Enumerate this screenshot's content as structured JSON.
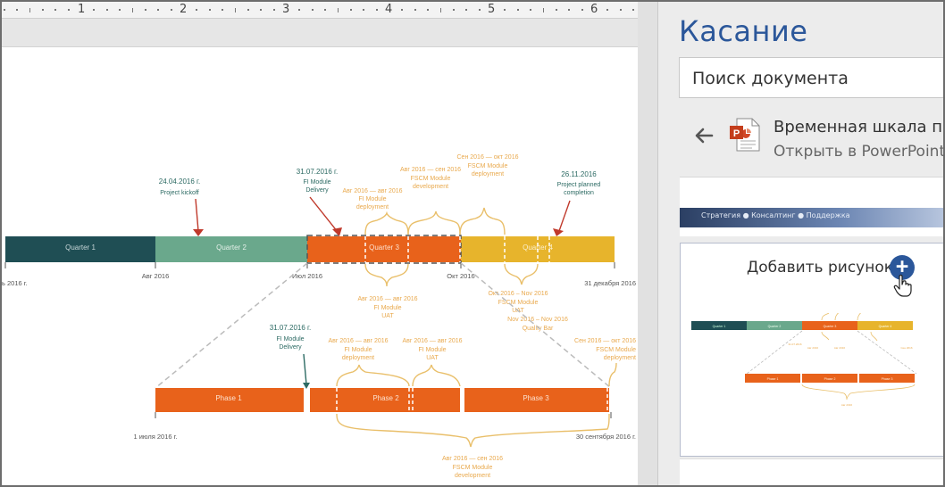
{
  "ruler": {
    "numbers": [
      "1",
      "2",
      "3",
      "4",
      "5",
      "6"
    ]
  },
  "timeline": {
    "main_bar": [
      {
        "label": "Quarter 1",
        "color": "#1f4e54"
      },
      {
        "label": "Quarter 2",
        "color": "#6aa88c"
      },
      {
        "label": "Quarter 3",
        "color": "#e8621b"
      },
      {
        "label": "Quarter 4",
        "color": "#e7b42c"
      }
    ],
    "main_axis": {
      "start": "ь 2016 г.",
      "aug": "Авг 2016",
      "jul": "Июл 2016",
      "oct": "Окт 2016",
      "end": "31 декабря 2016"
    },
    "milestones": [
      {
        "date": "24.04.2016 г.",
        "text": [
          "Project kickoff"
        ]
      },
      {
        "date": "31.07.2016 г.",
        "text": [
          "FI Module",
          "Delivery"
        ]
      },
      {
        "date": "26.11.2016",
        "text": [
          "Project planned",
          "completion"
        ]
      }
    ],
    "top_orange": [
      {
        "range": "Авг 2016 — авг 2016",
        "text": [
          "FI Module",
          "deployment"
        ]
      },
      {
        "range": "Авг 2016 — сен 2016",
        "text": [
          "FSCM Module",
          "development"
        ]
      },
      {
        "range": "Сен 2016 — окт 2016",
        "text": [
          "FSCM Module",
          "deployment"
        ]
      }
    ],
    "below_main": [
      {
        "range": "Авг 2016 — авг 2016",
        "text": [
          "FI Module",
          "UAT"
        ]
      },
      {
        "range": "Окт 2016 – Nov 2016",
        "text": [
          "FSCM Module",
          "UAT"
        ]
      },
      {
        "range": "Nov 2016 – Nov 2016",
        "text": [
          "Quality Bar"
        ]
      }
    ],
    "phase_bar": [
      {
        "label": "Phase 1"
      },
      {
        "label": "Phase 2"
      },
      {
        "label": "Phase 3"
      }
    ],
    "phase_axis": {
      "start": "1 июля 2016 г.",
      "end": "30 сентября 2016 г."
    },
    "phase_milestone": {
      "date": "31.07.2016 г.",
      "text": [
        "FI Module",
        "Delivery"
      ]
    },
    "phase_above": [
      {
        "range": "Авг 2016 — авг 2016",
        "text": [
          "FI Module",
          "deployment"
        ]
      },
      {
        "range": "Авг 2016 — авг 2016",
        "text": [
          "FI Module",
          "UAT"
        ]
      },
      {
        "range": "Сен 2016 — окт 2016",
        "text": [
          "FSCM Module",
          "deployment"
        ]
      }
    ],
    "phase_below": {
      "range": "Авг 2016 — сен 2016",
      "text": [
        "FSCM Module",
        "development"
      ]
    }
  },
  "pane": {
    "title": "Касание",
    "search_placeholder": "Поиск документа",
    "document_title": "Временная шкала проекта",
    "open_in": "Открыть в PowerPoint",
    "thumb_banner": "Стратегия  ●  Консалтинг  ●  Поддержка",
    "add_picture": "Добавить рисунок",
    "mini_labels": [
      "Quarter 1",
      "Quarter 2",
      "Quarter 3",
      "Quarter 4",
      "Phase 1",
      "Phase 2",
      "Phase 3"
    ]
  },
  "colors": {
    "accent": "#2b579a",
    "q1": "#1f4e54",
    "q2": "#6aa88c",
    "q3": "#e8621b",
    "q4": "#e7b42c",
    "note_orange": "#e9a94d",
    "note_teal": "#2c6a63"
  },
  "icons": [
    "back-arrow-icon",
    "powerpoint-file-icon",
    "plus-icon",
    "hand-cursor-icon"
  ]
}
